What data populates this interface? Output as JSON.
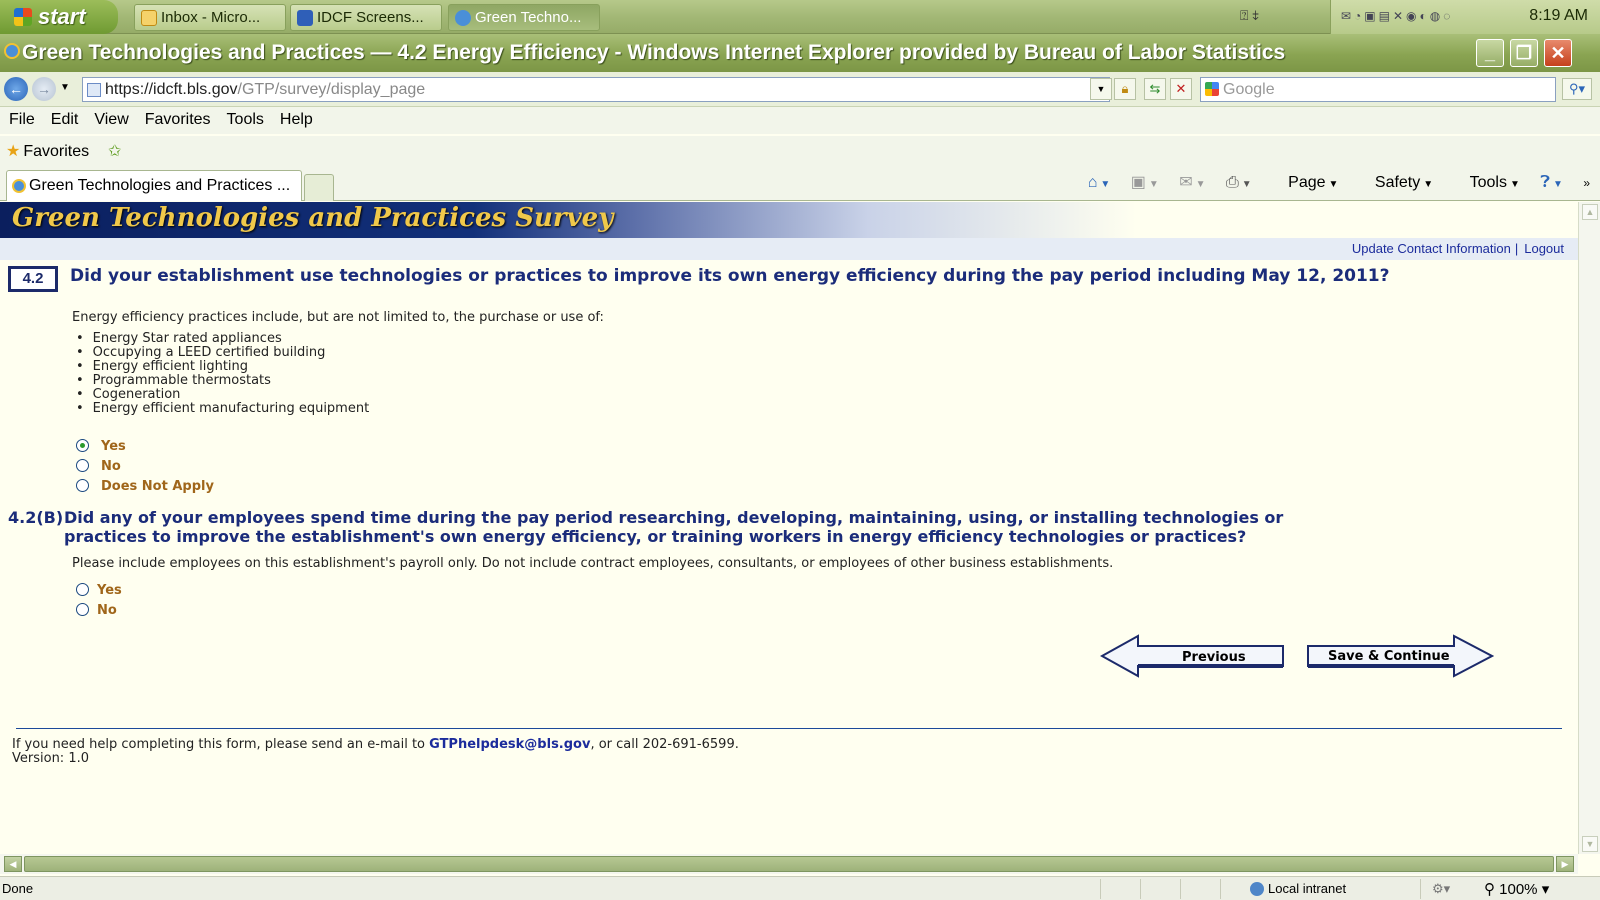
{
  "taskbar": {
    "start_label": "start",
    "tasks": [
      {
        "label": "Inbox - Micro..."
      },
      {
        "label": "IDCF Screens..."
      },
      {
        "label": "Green Techno..."
      }
    ],
    "clock": "8:19 AM"
  },
  "window": {
    "title": "Green Technologies and Practices — 4.2 Energy Efficiency - Windows Internet Explorer provided by Bureau of Labor Statistics"
  },
  "address_bar": {
    "url_host": "https://idcft.bls.gov",
    "url_path": "/GTP/survey/display_page",
    "search_placeholder": "Google"
  },
  "menu": {
    "items": [
      "File",
      "Edit",
      "View",
      "Favorites",
      "Tools",
      "Help"
    ]
  },
  "favorites_bar": {
    "label": "Favorites"
  },
  "tab": {
    "label": "Green Technologies and Practices ..."
  },
  "command_bar": {
    "page": "Page",
    "safety": "Safety",
    "tools": "Tools"
  },
  "page": {
    "banner_title": "Green Technologies and Practices Survey",
    "links": {
      "update_contact": "Update Contact Information",
      "logout": "Logout"
    },
    "q1": {
      "number": "4.2",
      "text": "Did your establishment use technologies or practices to improve its own energy efficiency during the pay period including May 12, 2011?",
      "intro": "Energy efficiency practices include, but are not limited to, the purchase or use of:",
      "bullets": [
        "Energy Star rated appliances",
        "Occupying a LEED certified building",
        "Energy efficient lighting",
        "Programmable thermostats",
        "Cogeneration",
        "Energy efficient manufacturing equipment"
      ],
      "options": [
        "Yes",
        "No",
        "Does Not Apply"
      ],
      "selected": "Yes"
    },
    "q2": {
      "number": "4.2(B)",
      "text": "Did any of your employees spend time during the pay period researching, developing, maintaining, using, or installing technologies or practices to improve the establishment's own energy efficiency, or training workers in energy efficiency technologies or practices?",
      "note": "Please include employees on this establishment's payroll only. Do not include contract employees, consultants, or employees of other business establishments.",
      "options": [
        "Yes",
        "No"
      ],
      "selected": null
    },
    "buttons": {
      "previous": "Previous",
      "save_continue": "Save & Continue"
    },
    "footer": {
      "help_prefix": "If you need help completing this form, please send an e-mail to ",
      "help_email": "GTPhelpdesk@bls.gov",
      "help_suffix": ", or call 202-691-6599.",
      "version": "Version: 1.0"
    }
  },
  "status_bar": {
    "status": "Done",
    "zone": "Local intranet",
    "zoom": "100%"
  }
}
